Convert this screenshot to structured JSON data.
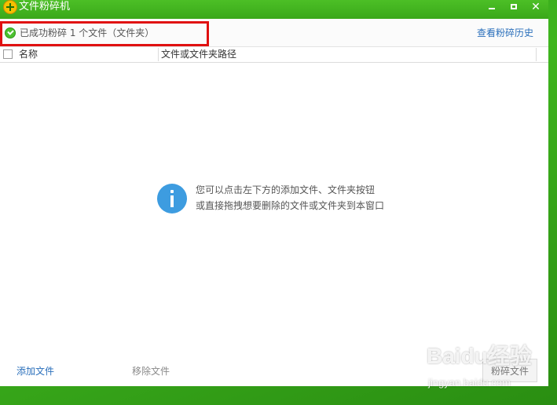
{
  "window": {
    "title": "文件粉碎机",
    "minimize_glyph": "",
    "close_glyph": "✕"
  },
  "status": {
    "message": "已成功粉碎 1 个文件（文件夹）",
    "history_link": "查看粉碎历史"
  },
  "table": {
    "columns": [
      "名称",
      "文件或文件夹路径"
    ]
  },
  "empty_hint": {
    "line1": "您可以点击左下方的添加文件、文件夹按钮",
    "line2": "或直接拖拽想要删除的文件或文件夹到本窗口"
  },
  "footer": {
    "add_label": "添加文件",
    "remove_label": "移除文件",
    "shred_label": "粉碎文件"
  },
  "watermark": {
    "main": "Baidu经验",
    "sub": "jingyan.baidu.com"
  },
  "colors": {
    "titlebar": "#3aa81a",
    "highlight_border": "#e01010",
    "link": "#2a6fbb",
    "info_icon": "#3d9ce0",
    "success": "#4cc02f"
  }
}
